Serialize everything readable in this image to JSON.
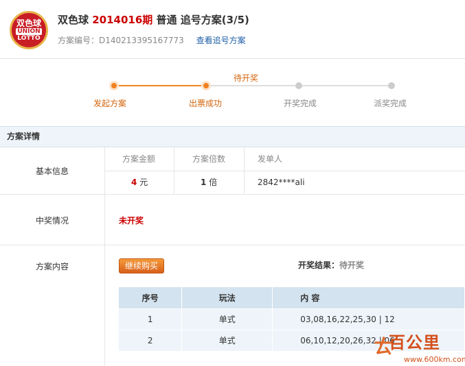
{
  "header": {
    "logo": {
      "line1": "双色球",
      "line2": "UNION",
      "line3": "LOTTO"
    },
    "lottery": "双色球",
    "issue": "2014016期",
    "type": "普通",
    "plan": "追号方案(3/5)",
    "plan_no_label": "方案编号：",
    "plan_no": "D140213395167773",
    "view_link": "查看追号方案"
  },
  "progress": {
    "pending_label": "待开奖",
    "steps": [
      {
        "label": "发起方案",
        "state": "done"
      },
      {
        "label": "出票成功",
        "state": "done"
      },
      {
        "label": "开奖完成",
        "state": "todo"
      },
      {
        "label": "派奖完成",
        "state": "todo"
      }
    ]
  },
  "section": {
    "title": "方案详情"
  },
  "basic": {
    "label": "基本信息",
    "headers": [
      "方案金额",
      "方案倍数",
      "发单人"
    ],
    "amount": "4",
    "amount_unit": "元",
    "multiple": "1",
    "multiple_unit": "倍",
    "initiator": "2842****ali"
  },
  "prize": {
    "label": "中奖情况",
    "status": "未开奖"
  },
  "content": {
    "label": "方案内容",
    "buy_button": "继续购买",
    "result_label": "开奖结果：",
    "result_value": "待开奖",
    "table": {
      "headers": [
        "序号",
        "玩法",
        "内 容"
      ],
      "rows": [
        [
          "1",
          "单式",
          "03,08,16,22,25,30 | 12"
        ],
        [
          "2",
          "单式",
          "06,10,12,20,26,32 | 06"
        ]
      ]
    }
  },
  "watermark": {
    "text": "百公里",
    "url": "www.600km.com"
  },
  "colors": {
    "accent": "#f0821f",
    "red": "#cc0000",
    "link": "#1f5fa8",
    "header_bg": "#eef4fa"
  }
}
